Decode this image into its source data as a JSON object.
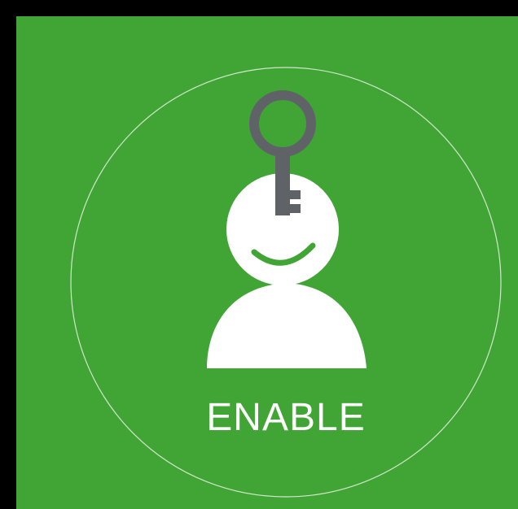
{
  "badge": {
    "label": "ENABLE",
    "icon": "person-with-key-icon"
  },
  "colors": {
    "background": "#41a535",
    "frame": "#000000",
    "figure": "#ffffff",
    "key": "#5f6368",
    "ring": "#cfe8ca"
  }
}
